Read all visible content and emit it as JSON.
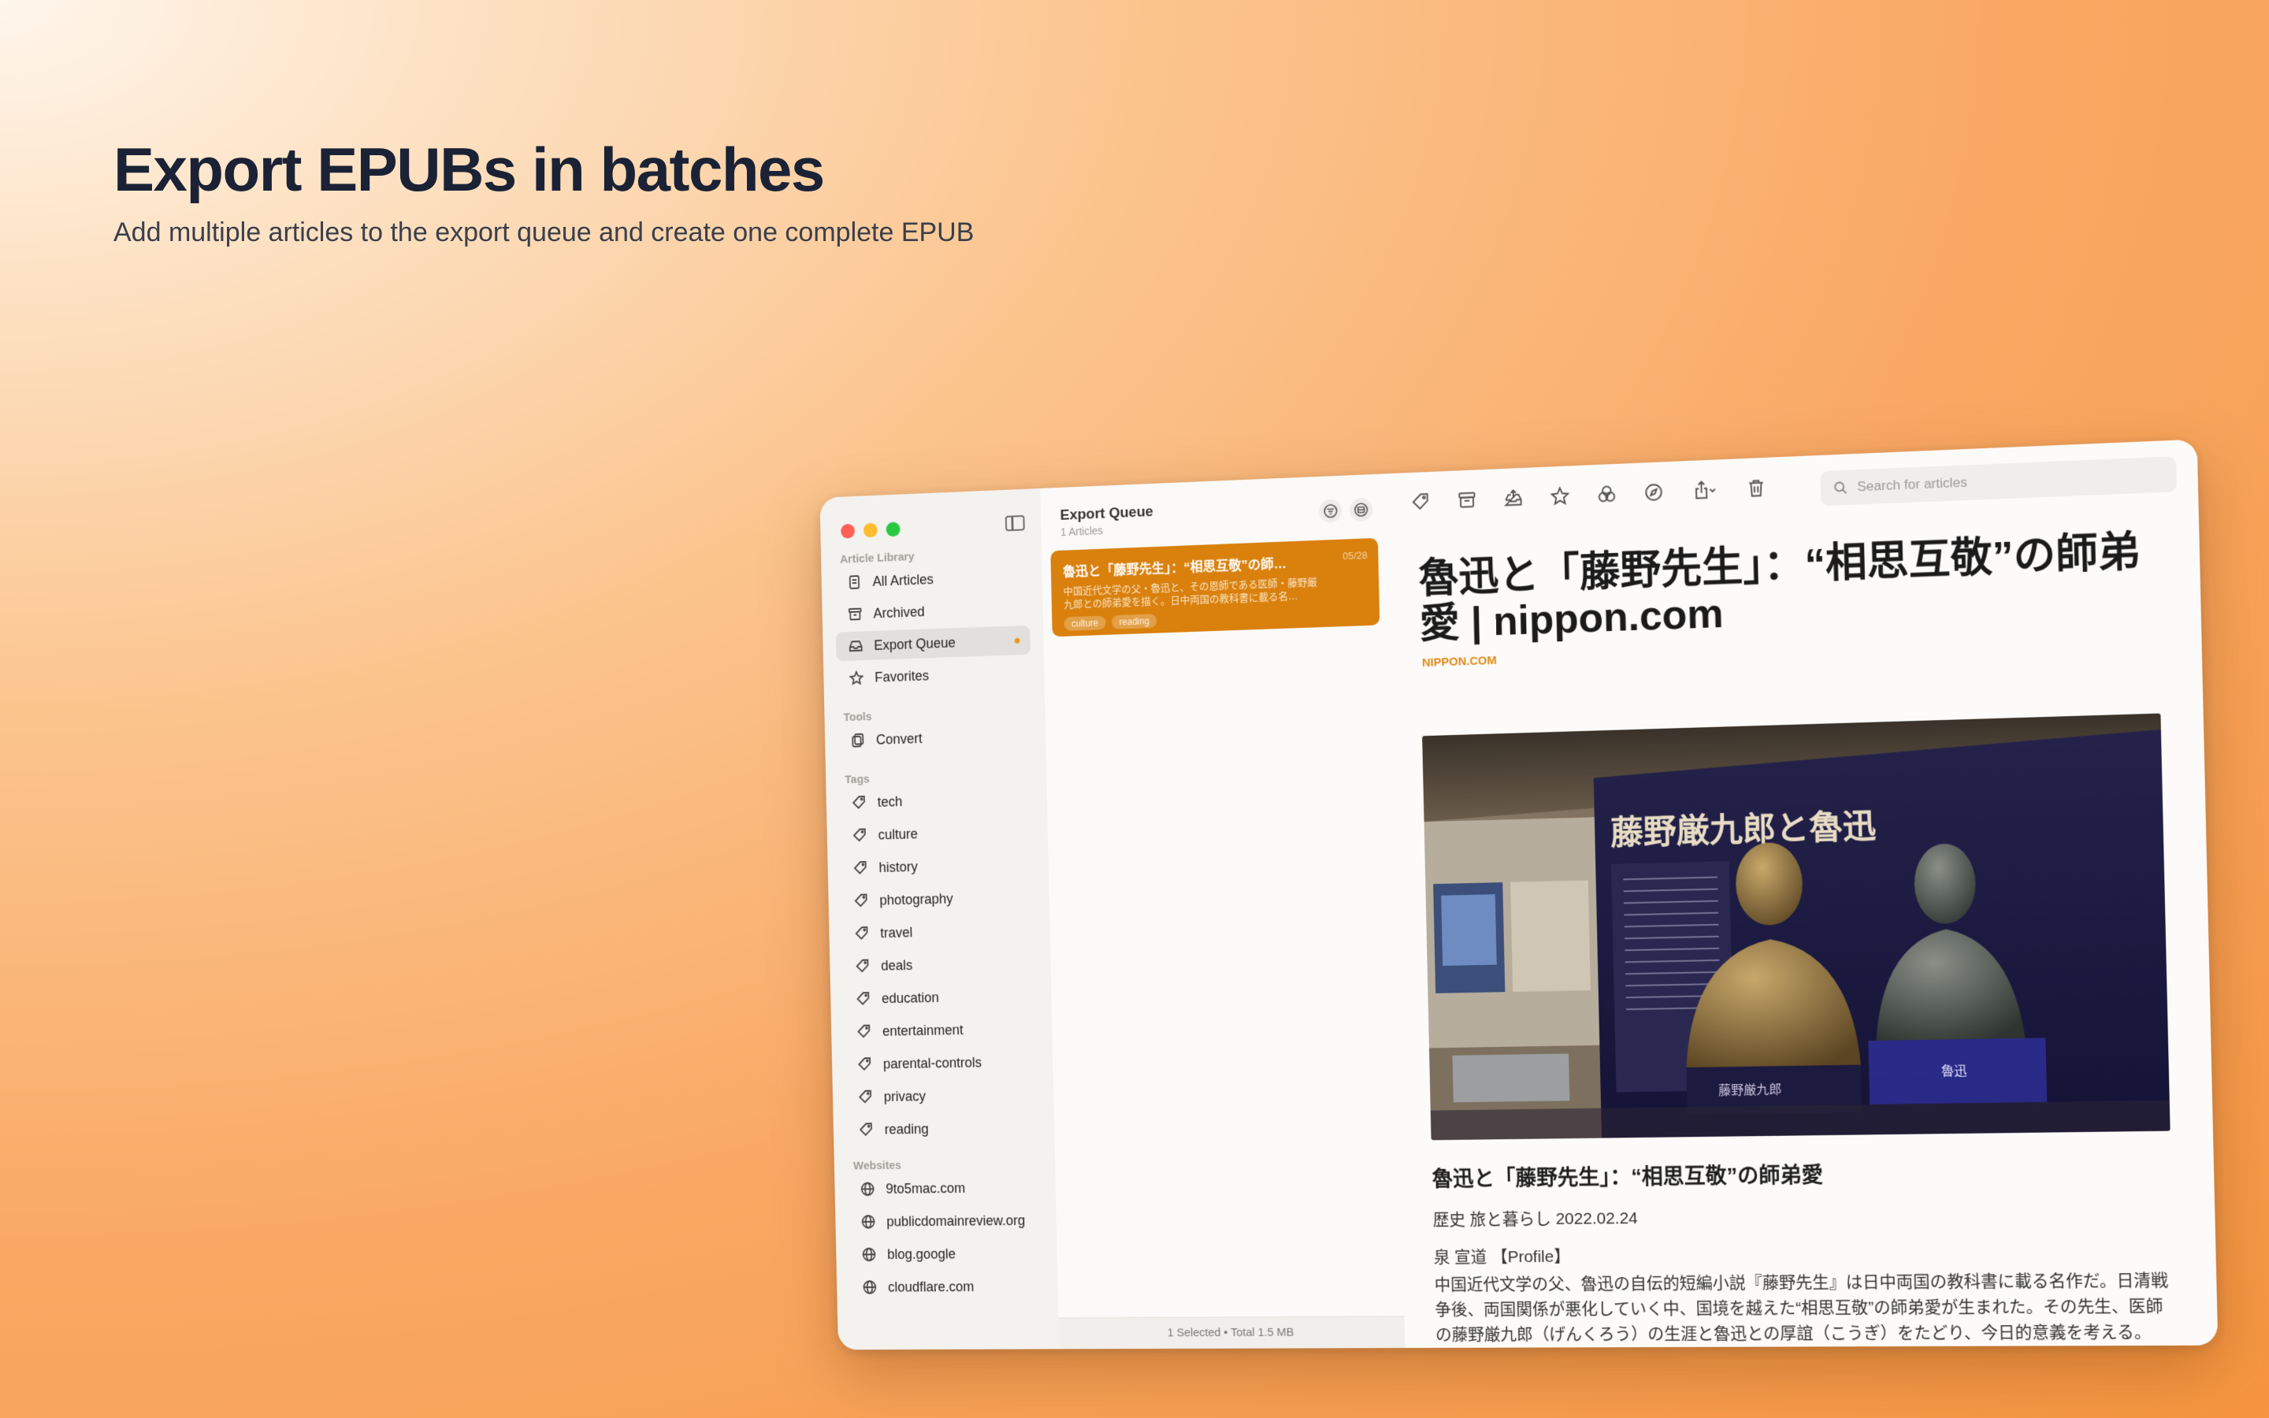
{
  "hero": {
    "title": "Export EPUBs in batches",
    "subtitle": "Add multiple articles to the export queue and create one complete EPUB"
  },
  "sidebar": {
    "library_title": "Article Library",
    "library_items": [
      {
        "label": "All Articles",
        "icon": "doc-icon"
      },
      {
        "label": "Archived",
        "icon": "archive-icon"
      },
      {
        "label": "Export Queue",
        "icon": "tray-icon",
        "active": true
      },
      {
        "label": "Favorites",
        "icon": "star-icon"
      }
    ],
    "tools_title": "Tools",
    "tools_items": [
      {
        "label": "Convert",
        "icon": "convert-icon"
      }
    ],
    "tags_title": "Tags",
    "tags": [
      "tech",
      "culture",
      "history",
      "photography",
      "travel",
      "deals",
      "education",
      "entertainment",
      "parental-controls",
      "privacy",
      "reading"
    ],
    "websites_title": "Websites",
    "websites": [
      "9to5mac.com",
      "publicdomainreview.org",
      "blog.google",
      "cloudflare.com"
    ]
  },
  "list": {
    "title": "Export Queue",
    "count": "1 Articles",
    "card": {
      "title": "魯迅と「藤野先生」：“相思互敬”の師…",
      "date": "05/28",
      "summary": "中国近代文学の父・魯迅と、その恩師である医師・藤野厳九郎との師弟愛を描く。日中両国の教科書に載る名…",
      "tags": [
        "culture",
        "reading"
      ]
    },
    "status": "1 Selected • Total 1.5 MB"
  },
  "reader": {
    "search_placeholder": "Search for articles",
    "title": "魯迅と「藤野先生」：“相思互敬”の師弟愛 | nippon.com",
    "source": "NIPPON.COM",
    "image_sign": "藤野厳九郎と魯迅",
    "image_label_left": "藤野厳九郎",
    "image_label_right": "魯迅",
    "subtitle": "魯迅と「藤野先生」：“相思互敬”の師弟愛",
    "meta": "歴史 旅と暮らし 2022.02.24",
    "author": "泉 宣道 【Profile】",
    "body": "中国近代文学の父、魯迅の自伝的短編小説『藤野先生』は日中両国の教科書に載る名作だ。日清戦争後、両国関係が悪化していく中、国境を越えた“相思互敬”の師弟愛が生まれた。その先生、医師の藤野厳九郎（げんくろう）の生涯と魯迅との厚誼（こうぎ）をたどり、今日的意義を考える。"
  },
  "colors": {
    "accent": "#d9800d",
    "queue_dot": "#f0951e"
  }
}
